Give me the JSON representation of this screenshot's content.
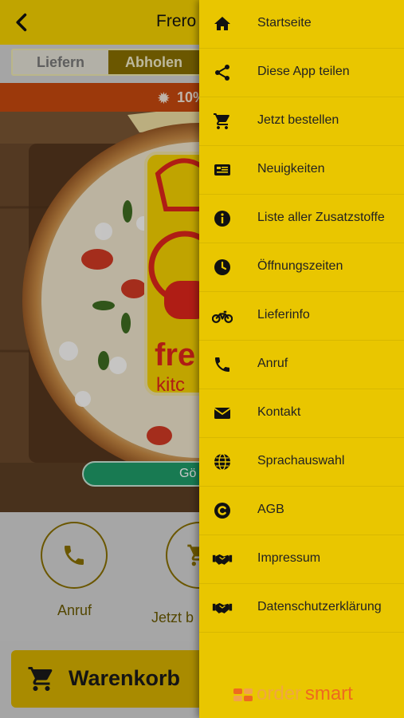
{
  "app": {
    "title": "Frero I",
    "tabs": {
      "deliver": "Liefern",
      "pickup": "Abholen",
      "selected": "Abholen"
    },
    "promo": {
      "text": "10%"
    },
    "open_status": "Gö",
    "logo_text": {
      "line1": "fre",
      "line2": "kitc"
    },
    "actions": {
      "call": "Anruf",
      "order": "Jetzt b"
    },
    "cart_label": "Warenkorb"
  },
  "drawer": {
    "items": [
      {
        "label": "Startseite",
        "icon": "home-icon"
      },
      {
        "label": "Diese App teilen",
        "icon": "share-icon"
      },
      {
        "label": "Jetzt bestellen",
        "icon": "cart-icon"
      },
      {
        "label": "Neuigkeiten",
        "icon": "news-icon"
      },
      {
        "label": "Liste aller Zusatzstoffe",
        "icon": "info-icon"
      },
      {
        "label": "Öffnungszeiten",
        "icon": "clock-icon"
      },
      {
        "label": "Lieferinfo",
        "icon": "motorcycle-icon"
      },
      {
        "label": "Anruf",
        "icon": "phone-icon"
      },
      {
        "label": "Kontakt",
        "icon": "envelope-icon"
      },
      {
        "label": "Sprachauswahl",
        "icon": "globe-icon"
      },
      {
        "label": "AGB",
        "icon": "copyright-icon"
      },
      {
        "label": "Impressum",
        "icon": "handshake-icon"
      },
      {
        "label": "Datenschutzerklärung",
        "icon": "handshake-icon"
      }
    ],
    "brand": {
      "word1": "order",
      "word2": "smart"
    }
  },
  "colors": {
    "brand_yellow": "#f6d300",
    "drawer_yellow": "#e9c600",
    "accent_olive": "#8a7000",
    "promo_orange": "#c84a0f",
    "open_green": "#1f9d6a"
  }
}
